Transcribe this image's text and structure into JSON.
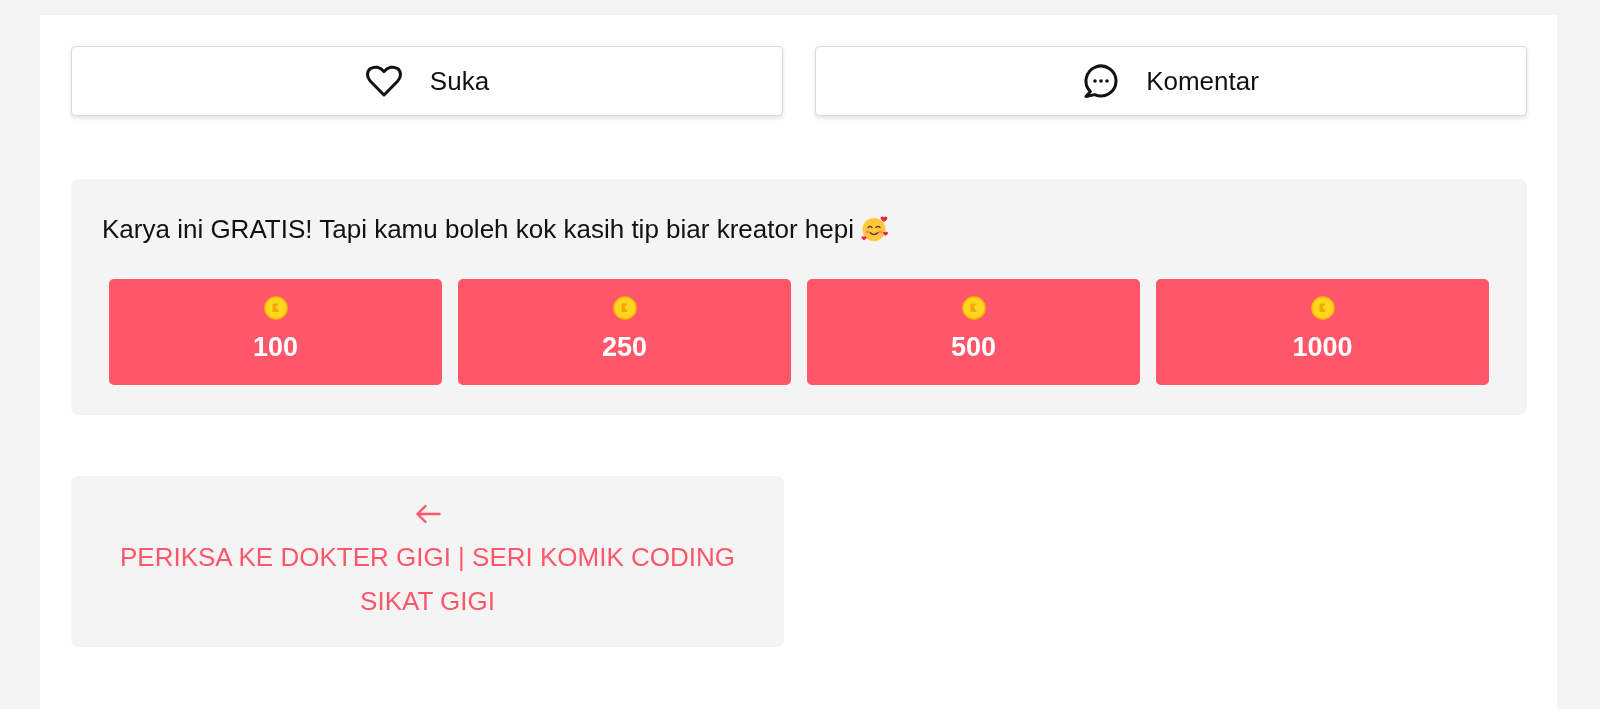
{
  "actions": [
    {
      "kind": "like",
      "label": "Suka"
    },
    {
      "kind": "comment",
      "label": "Komentar"
    }
  ],
  "tip": {
    "message": "Karya ini GRATIS! Tapi kamu boleh kok kasih tip biar kreator hepi",
    "amounts": [
      "100",
      "250",
      "500",
      "1000"
    ]
  },
  "previous_post": {
    "title": "PERIKSA KE DOKTER GIGI | SERI KOMIK CODING SIKAT GIGI"
  }
}
